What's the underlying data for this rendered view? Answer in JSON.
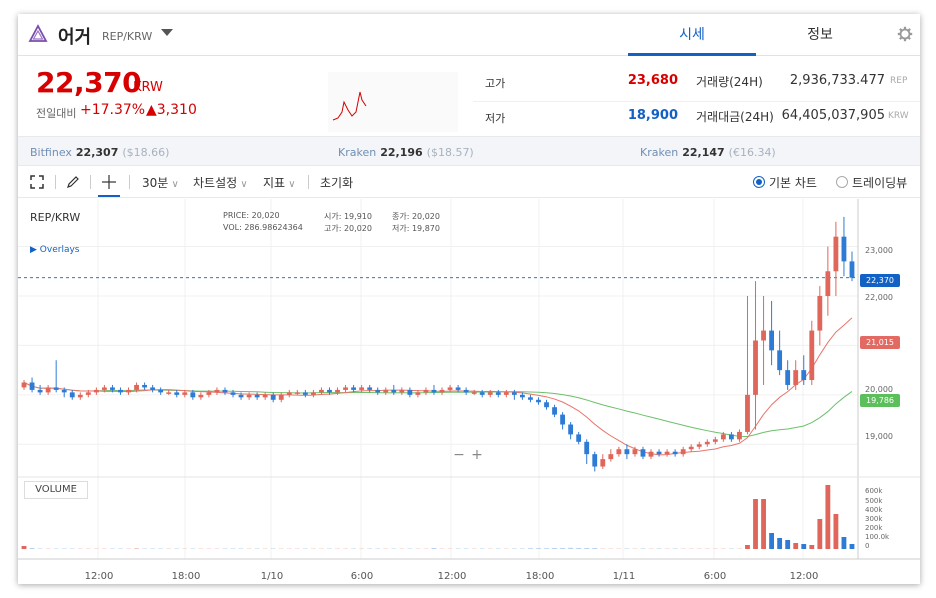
{
  "header": {
    "coin_name": "어거",
    "pair": "REP/KRW",
    "tabs": [
      "시세",
      "정보"
    ]
  },
  "price": {
    "current": "22,370",
    "unit": "KRW",
    "change_label": "전일대비",
    "change_rate": "+17.37%",
    "change_amount": "▲3,310",
    "color_up": "#d60000"
  },
  "stats": {
    "high_label": "고가",
    "high": "23,680",
    "low_label": "저가",
    "low": "18,900",
    "volume_label": "거래량(24H)",
    "volume": "2,936,733.477",
    "volume_unit": "REP",
    "amount_label": "거래대금(24H)",
    "amount": "64,405,037,905",
    "amount_unit": "KRW"
  },
  "exchanges": [
    {
      "name": "Bitfinex",
      "price": "22,307",
      "alt": "($18.66)"
    },
    {
      "name": "Kraken",
      "price": "22,196",
      "alt": "($18.57)"
    },
    {
      "name": "Kraken",
      "price": "22,147",
      "alt": "(€16.34)"
    }
  ],
  "toolbar": {
    "interval": "30분",
    "chart_settings": "차트설정",
    "indicators": "지표",
    "reset": "초기화",
    "basic_chart": "기본 차트",
    "trading_view": "트레이딩뷰"
  },
  "chart_info": {
    "pair": "REP/KRW",
    "price_label": "PRICE:",
    "price": "20,020",
    "vol_label": "VOL:",
    "vol": "286.98624364",
    "open_label": "시가:",
    "open": "19,910",
    "close_label": "종가:",
    "close": "20,020",
    "high_label": "고가:",
    "high": "20,020",
    "low_label": "저가:",
    "low": "19,870",
    "overlays": "Overlays",
    "volume_label": "VOLUME"
  },
  "chart_data": {
    "type": "candlestick",
    "x_ticks": [
      "12:00",
      "18:00",
      "1/10",
      "6:00",
      "12:00",
      "18:00",
      "1/11",
      "6:00",
      "12:00"
    ],
    "y_ticks": [
      "23,000",
      "22,000",
      "21,000",
      "20,000",
      "19,000"
    ],
    "volume_ticks": [
      "600k",
      "500k",
      "400k",
      "300k",
      "200k",
      "100.0k",
      "0"
    ],
    "current_price_label": "22,370",
    "ma_short_label": "21,015",
    "ma_long_label": "19,786",
    "colors": {
      "up": "#e0655a",
      "down": "#2e7bd6",
      "ma_short": "#e8756b",
      "ma_long": "#6cc06c",
      "current": "#1261c4"
    },
    "ylim": [
      18500,
      23800
    ],
    "candles": [
      [
        20150,
        20250,
        20100,
        20300
      ],
      [
        20250,
        20100,
        20050,
        20350
      ],
      [
        20100,
        20050,
        20000,
        20200
      ],
      [
        20050,
        20150,
        20000,
        20200
      ],
      [
        20150,
        20100,
        20050,
        20700
      ],
      [
        20100,
        20050,
        19950,
        20150
      ],
      [
        20050,
        19950,
        19900,
        20100
      ],
      [
        19950,
        20000,
        19900,
        20050
      ],
      [
        20000,
        20050,
        19950,
        20100
      ],
      [
        20050,
        20100,
        20000,
        20150
      ],
      [
        20100,
        20150,
        20050,
        20200
      ],
      [
        20150,
        20100,
        20050,
        20200
      ],
      [
        20100,
        20050,
        20000,
        20150
      ],
      [
        20050,
        20100,
        20000,
        20150
      ],
      [
        20100,
        20200,
        20050,
        20250
      ],
      [
        20200,
        20150,
        20100,
        20250
      ],
      [
        20150,
        20100,
        20050,
        20200
      ],
      [
        20100,
        20050,
        20000,
        20150
      ],
      [
        20050,
        20050,
        20000,
        20100
      ],
      [
        20050,
        20000,
        19950,
        20100
      ],
      [
        20000,
        20050,
        19950,
        20100
      ],
      [
        20050,
        19950,
        19900,
        20100
      ],
      [
        19950,
        20000,
        19900,
        20050
      ],
      [
        20000,
        20050,
        19950,
        20100
      ],
      [
        20050,
        20100,
        20000,
        20150
      ],
      [
        20100,
        20050,
        20000,
        20150
      ],
      [
        20050,
        20000,
        19950,
        20100
      ],
      [
        20000,
        19950,
        19900,
        20050
      ],
      [
        19950,
        20000,
        19900,
        20050
      ],
      [
        20000,
        19950,
        19900,
        20050
      ],
      [
        19950,
        20000,
        19900,
        20050
      ],
      [
        20000,
        19900,
        19850,
        20050
      ],
      [
        19900,
        20000,
        19850,
        20050
      ],
      [
        20000,
        20050,
        19950,
        20100
      ],
      [
        20050,
        20050,
        20000,
        20100
      ],
      [
        20050,
        20000,
        19950,
        20100
      ],
      [
        20000,
        20050,
        19950,
        20100
      ],
      [
        20050,
        20100,
        20000,
        20150
      ],
      [
        20100,
        20050,
        20000,
        20150
      ],
      [
        20050,
        20100,
        20000,
        20150
      ],
      [
        20100,
        20150,
        20050,
        20200
      ],
      [
        20150,
        20100,
        20050,
        20200
      ],
      [
        20100,
        20150,
        20050,
        20200
      ],
      [
        20150,
        20100,
        20050,
        20200
      ],
      [
        20100,
        20050,
        20000,
        20150
      ],
      [
        20050,
        20100,
        20000,
        20150
      ],
      [
        20100,
        20050,
        20000,
        20200
      ],
      [
        20050,
        20100,
        20000,
        20150
      ],
      [
        20100,
        20000,
        19950,
        20150
      ],
      [
        20000,
        20050,
        19950,
        20100
      ],
      [
        20050,
        20100,
        20000,
        20150
      ],
      [
        20100,
        20050,
        20000,
        20200
      ],
      [
        20050,
        20100,
        20000,
        20150
      ],
      [
        20100,
        20150,
        20050,
        20200
      ],
      [
        20150,
        20100,
        20050,
        20200
      ],
      [
        20100,
        20050,
        20000,
        20150
      ],
      [
        20050,
        20050,
        20000,
        20100
      ],
      [
        20050,
        20000,
        19950,
        20100
      ],
      [
        20000,
        20050,
        19950,
        20100
      ],
      [
        20050,
        20000,
        19950,
        20100
      ],
      [
        20000,
        20050,
        19950,
        20100
      ],
      [
        20050,
        20000,
        19900,
        20100
      ],
      [
        20000,
        19950,
        19900,
        20050
      ],
      [
        19950,
        19900,
        19850,
        20000
      ],
      [
        19900,
        19850,
        19800,
        19950
      ],
      [
        19850,
        19750,
        19700,
        19900
      ],
      [
        19750,
        19600,
        19550,
        19800
      ],
      [
        19600,
        19400,
        19300,
        19650
      ],
      [
        19400,
        19200,
        19100,
        19450
      ],
      [
        19200,
        19050,
        19000,
        19250
      ],
      [
        19050,
        18800,
        18600,
        19100
      ],
      [
        18800,
        18550,
        18450,
        18850
      ],
      [
        18550,
        18700,
        18500,
        18800
      ],
      [
        18700,
        18800,
        18650,
        18900
      ],
      [
        18800,
        18900,
        18750,
        18950
      ],
      [
        18900,
        18800,
        18700,
        19000
      ],
      [
        18800,
        18900,
        18750,
        18950
      ],
      [
        18900,
        18750,
        18700,
        18950
      ],
      [
        18750,
        18850,
        18700,
        18900
      ],
      [
        18850,
        18800,
        18750,
        18900
      ],
      [
        18800,
        18850,
        18750,
        18900
      ],
      [
        18850,
        18800,
        18750,
        18900
      ],
      [
        18800,
        18900,
        18750,
        18950
      ],
      [
        18900,
        18950,
        18850,
        19000
      ],
      [
        18950,
        19000,
        18900,
        19050
      ],
      [
        19000,
        19050,
        18950,
        19100
      ],
      [
        19050,
        19100,
        19000,
        19150
      ],
      [
        19100,
        19200,
        19050,
        19250
      ],
      [
        19200,
        19100,
        19050,
        19250
      ],
      [
        19100,
        19250,
        19050,
        19300
      ],
      [
        19250,
        20000,
        19200,
        22000
      ],
      [
        20000,
        21100,
        19300,
        22300
      ],
      [
        21100,
        21300,
        20200,
        22000
      ],
      [
        21300,
        20900,
        20600,
        21900
      ],
      [
        20900,
        20500,
        20400,
        21300
      ],
      [
        20500,
        20200,
        20100,
        20700
      ],
      [
        20200,
        20500,
        20100,
        20700
      ],
      [
        20500,
        20300,
        20200,
        20800
      ],
      [
        20300,
        21300,
        20200,
        21500
      ],
      [
        21300,
        22000,
        21000,
        22200
      ],
      [
        22000,
        22500,
        21600,
        23000
      ],
      [
        22500,
        23200,
        22000,
        23500
      ],
      [
        23200,
        22700,
        22400,
        23600
      ],
      [
        22700,
        22370,
        22300,
        22900
      ]
    ],
    "volumes": [
      30,
      10,
      5,
      5,
      5,
      5,
      5,
      5,
      5,
      5,
      5,
      5,
      5,
      5,
      10,
      5,
      5,
      5,
      5,
      5,
      5,
      5,
      5,
      5,
      5,
      5,
      5,
      5,
      5,
      5,
      5,
      5,
      5,
      5,
      5,
      5,
      5,
      5,
      5,
      5,
      5,
      5,
      5,
      5,
      5,
      5,
      5,
      5,
      5,
      5,
      5,
      10,
      5,
      5,
      5,
      5,
      5,
      5,
      5,
      5,
      5,
      5,
      5,
      8,
      8,
      8,
      10,
      10,
      12,
      10,
      10,
      10,
      5,
      5,
      5,
      5,
      5,
      5,
      5,
      5,
      5,
      5,
      5,
      5,
      5,
      5,
      5,
      5,
      5,
      5,
      40,
      500,
      500,
      160,
      110,
      90,
      60,
      50,
      40,
      300,
      640,
      350,
      120,
      50
    ]
  }
}
